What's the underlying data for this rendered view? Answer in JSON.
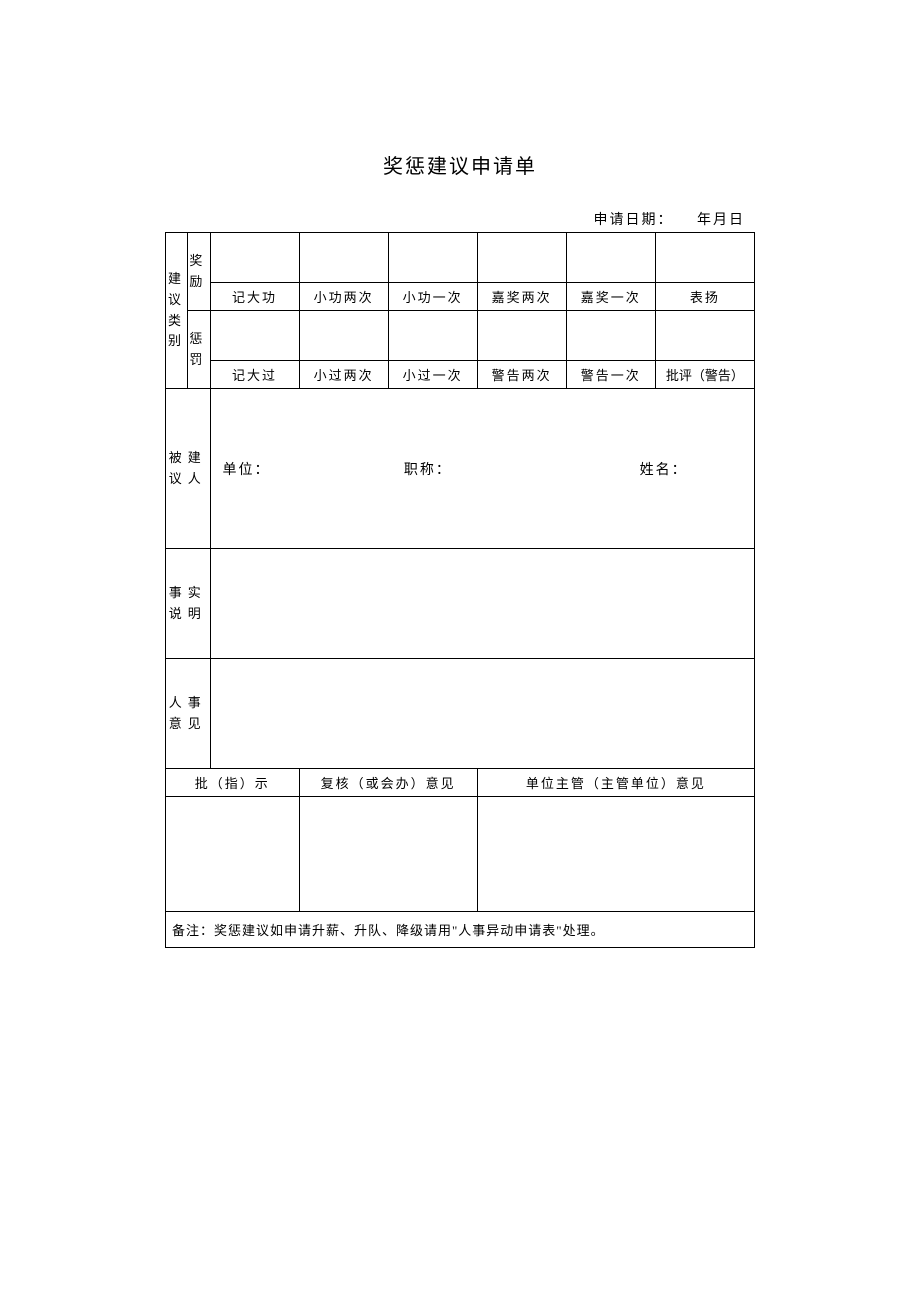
{
  "title": "奖惩建议申请单",
  "date": {
    "label": "申请日期：",
    "value": "年月日"
  },
  "rows": {
    "category_label": "建议类别",
    "reward_sub": "奖励",
    "punish_sub": "惩罚",
    "reward_opts": [
      "记大功",
      "小功两次",
      "小功一次",
      "嘉奖两次",
      "嘉奖一次",
      "表扬"
    ],
    "punish_opts": [
      "记大过",
      "小过两次",
      "小过一次",
      "警告两次",
      "警告一次",
      "批评（警告）"
    ],
    "person_label": "被建议人",
    "person_fields": {
      "unit": "单位：",
      "title": "职称：",
      "name": "姓名："
    },
    "fact_label": "事实说明",
    "hr_label": "人事意见",
    "approval_headers": [
      "批（指）示",
      "复核（或会办）意见",
      "单位主管（主管单位）意见"
    ],
    "remark": "备注：奖惩建议如申请升薪、升队、降级请用\"人事异动申请表\"处理。"
  }
}
